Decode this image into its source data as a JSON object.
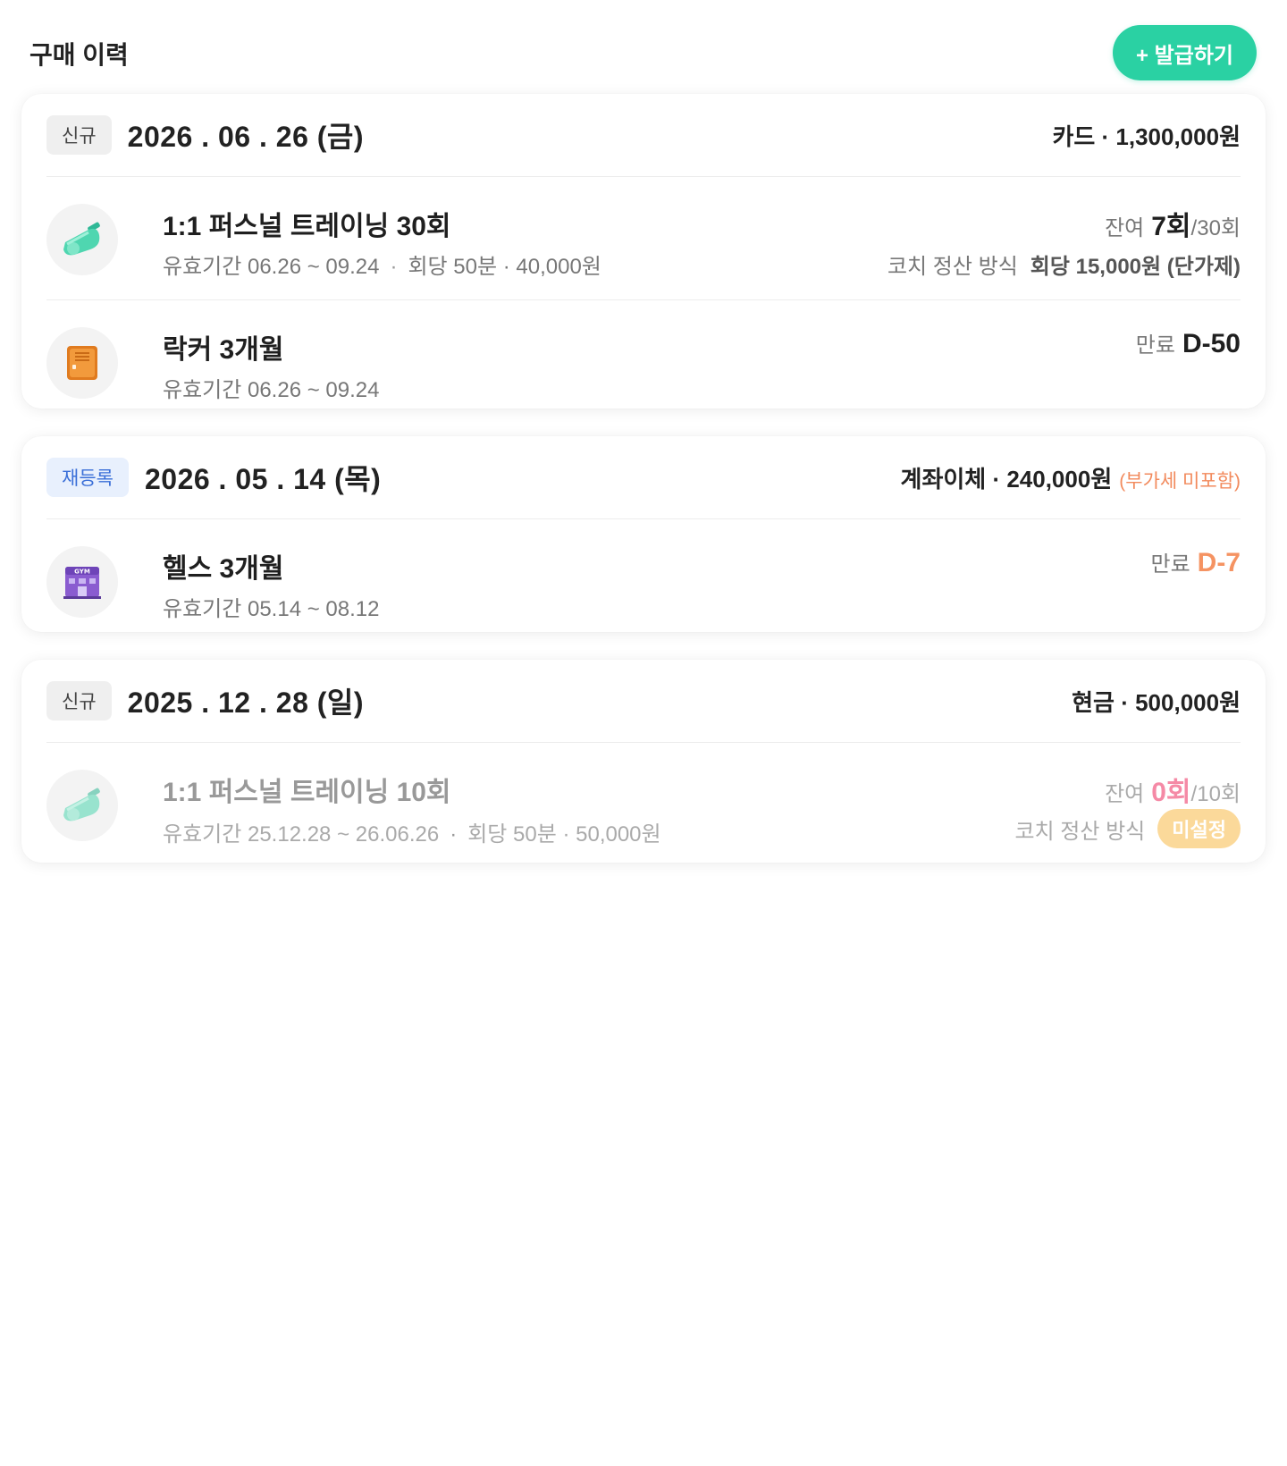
{
  "header": {
    "title": "구매 이력",
    "issue_button": "+ 발급하기"
  },
  "purchases": [
    {
      "badge": "신규",
      "date": "2026 . 06 . 26 (금)",
      "payment": "카드 · 1,300,000원",
      "items": [
        {
          "icon": "whistle-icon",
          "name": "1:1 퍼스널 트레이닝 30회",
          "period": "유효기간 06.26 ~ 09.24",
          "dot": "·",
          "detail": "회당 50분 · 40,000원",
          "remain_label": "잔여",
          "remain_value": "7회",
          "remain_total": "/30회",
          "settle_label": "코치 정산 방식",
          "settle_value": "회당 15,000원 (단가제)"
        },
        {
          "icon": "locker-icon",
          "name": "락커 3개월",
          "period": "유효기간 06.26 ~ 09.24",
          "expire_label": "만료",
          "expire_value": "D-50"
        }
      ]
    },
    {
      "badge": "재등록",
      "date": "2026 . 05 . 14 (목)",
      "payment": "계좌이체 · 240,000원",
      "vat_note": "(부가세 미포함)",
      "items": [
        {
          "icon": "gym-building-icon",
          "icon_text": "GYM",
          "name": "헬스 3개월",
          "period": "유효기간 05.14 ~ 08.12",
          "expire_label": "만료",
          "expire_value": "D-7"
        }
      ]
    },
    {
      "badge": "신규",
      "date": "2025 . 12 . 28 (일)",
      "payment": "현금 · 500,000원",
      "items": [
        {
          "icon": "whistle-icon",
          "name": "1:1 퍼스널 트레이닝 10회",
          "period": "유효기간 25.12.28 ~ 26.06.26",
          "dot": "·",
          "detail": "회당 50분 · 50,000원",
          "remain_label": "잔여",
          "remain_value": "0회",
          "remain_total": "/10회",
          "settle_label": "코치 정산 방식",
          "settle_value": "미설정"
        }
      ]
    }
  ],
  "colors": {
    "accent": "#2ad1a3",
    "warning_orange": "#f59362",
    "empty_pink": "#f58aa6",
    "unset_pill": "#fbd99a",
    "rebadge_blue": "#3a6fd8"
  }
}
